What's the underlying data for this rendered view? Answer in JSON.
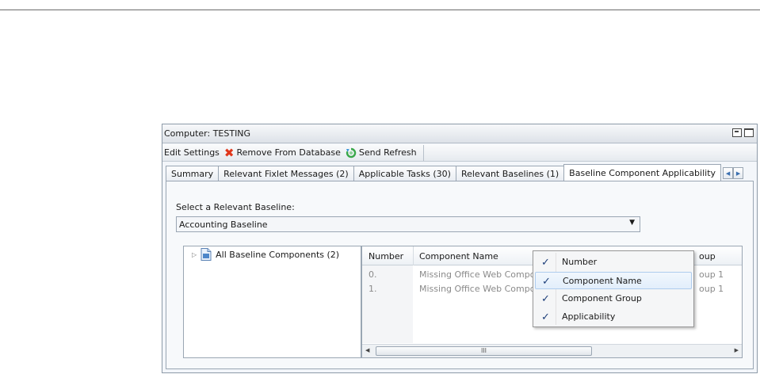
{
  "window": {
    "title": "Computer: TESTING"
  },
  "toolbar": {
    "edit_settings": "Edit Settings",
    "remove_from_database": "Remove From Database",
    "send_refresh": "Send Refresh"
  },
  "tabs": [
    {
      "label": "Summary"
    },
    {
      "label": "Relevant Fixlet Messages (2)"
    },
    {
      "label": "Applicable Tasks (30)"
    },
    {
      "label": "Relevant Baselines (1)"
    },
    {
      "label": "Baseline Component Applicability",
      "active": true
    }
  ],
  "baseline": {
    "select_label": "Select a Relevant Baseline:",
    "selected_value": "Accounting Baseline"
  },
  "tree": {
    "root_label": "All Baseline Components (2)"
  },
  "grid": {
    "headers": {
      "number": "Number",
      "component_name": "Component Name",
      "component_group_partial": "oup"
    },
    "rows": [
      {
        "number": "0.",
        "name": "Missing Office Web Compo",
        "group": "oup 1"
      },
      {
        "number": "1.",
        "name": "Missing Office Web Compo",
        "group": "oup 1"
      }
    ],
    "scroll_thumb_grip": "III"
  },
  "context_menu": {
    "items": [
      {
        "label": "Number",
        "checked": true
      },
      {
        "label": "Component Name",
        "checked": true
      },
      {
        "label": "Component Group",
        "checked": true
      },
      {
        "label": "Applicability",
        "checked": true
      }
    ],
    "check_glyph": "✓"
  },
  "colors": {
    "remove_icon": "#e0371b",
    "refresh_icon": "#3aa84a",
    "check": "#1e3f7a",
    "window_border": "#8d9aa8"
  }
}
